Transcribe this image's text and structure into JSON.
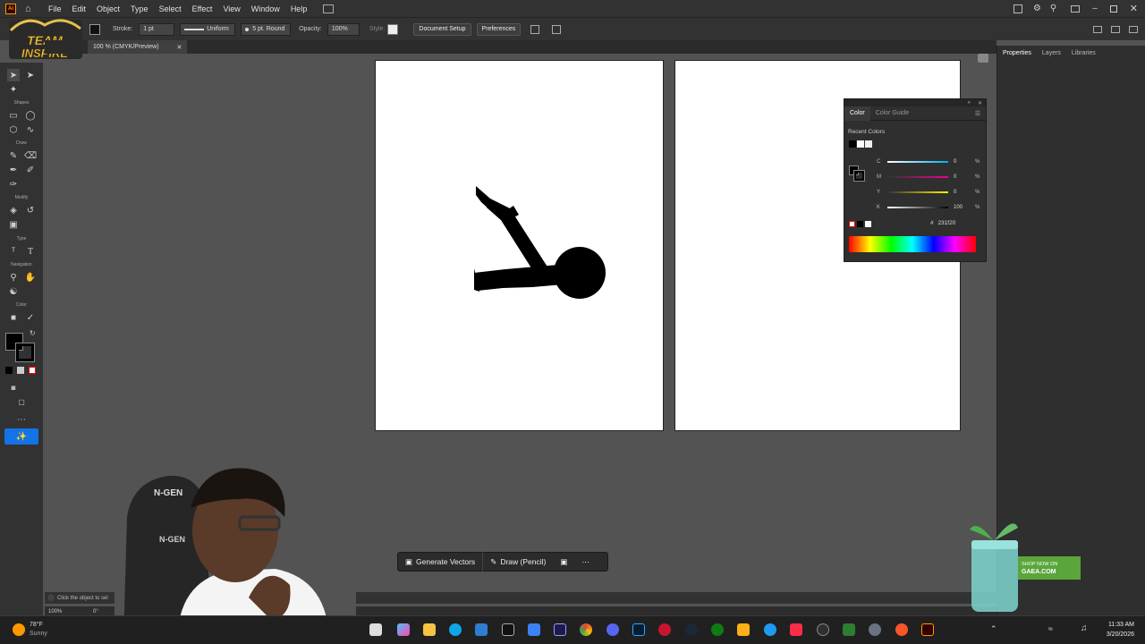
{
  "menu": {
    "app_icon": "Ai",
    "items": [
      "File",
      "Edit",
      "Object",
      "Type",
      "Select",
      "Effect",
      "View",
      "Window",
      "Help"
    ]
  },
  "control": {
    "stroke_label": "Stroke:",
    "stroke_value": "1 pt",
    "profile": "Uniform",
    "brush": "5 pt. Round",
    "opacity_label": "Opacity:",
    "opacity_value": "100%",
    "style_label": "Style:",
    "doc_setup": "Document Setup",
    "preferences": "Preferences"
  },
  "document_tab": {
    "title": "100 % (CMYK/Preview)"
  },
  "toolbar_sections": {
    "select": "Select",
    "shapes": "Shapes",
    "draw": "Draw",
    "modify": "Modify",
    "type": "Type",
    "navigation": "Navigation",
    "color": "Color"
  },
  "right_panel": {
    "tabs": [
      "Properties",
      "Layers",
      "Libraries"
    ]
  },
  "color_panel": {
    "tabs": [
      "Color",
      "Color Guide"
    ],
    "recent_label": "Recent Colors",
    "sliders": [
      {
        "label": "C",
        "value": "0",
        "color": "#00aeef"
      },
      {
        "label": "M",
        "value": "0",
        "color": "#ec008c"
      },
      {
        "label": "Y",
        "value": "0",
        "color": "#fff200"
      },
      {
        "label": "K",
        "value": "100",
        "color": "#000000"
      }
    ],
    "percent": "%",
    "hex_prefix": "#",
    "hex": "231f20"
  },
  "context_bar": {
    "generate": "Generate Vectors",
    "draw": "Draw (Pencil)"
  },
  "status": {
    "hint": "Click the object to sel",
    "zoom": "100%",
    "rotation": "0°"
  },
  "taskbar": {
    "temp": "78°F",
    "weather": "Sunny",
    "time": "11:33 AM",
    "date": "3/20/2026"
  },
  "overlays": {
    "watermark": "TEAM INSPIRE",
    "ad_text": "SHOP NOW ON",
    "ad_brand": "GAEA.COM",
    "chair_brand": "N-GEN"
  }
}
